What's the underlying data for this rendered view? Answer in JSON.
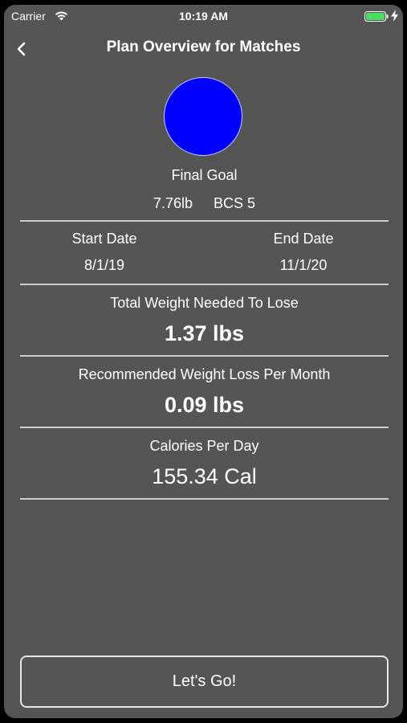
{
  "status_bar": {
    "carrier": "Carrier",
    "time": "10:19 AM",
    "battery_color": "#4cd964"
  },
  "nav": {
    "title": "Plan Overview for Matches",
    "back_icon": "chevron-left-icon"
  },
  "goal": {
    "avatar_color": "#0000ff",
    "label": "Final Goal",
    "weight": "7.76lb",
    "bcs": "BCS 5"
  },
  "dates": {
    "start_label": "Start Date",
    "start_value": "8/1/19",
    "end_label": "End Date",
    "end_value": "11/1/20"
  },
  "metrics": {
    "total_weight_label": "Total Weight Needed To Lose",
    "total_weight_value": "1.37 lbs",
    "monthly_loss_label": "Recommended Weight Loss Per Month",
    "monthly_loss_value": "0.09 lbs",
    "calories_label": "Calories Per Day",
    "calories_value": "155.34 Cal"
  },
  "action": {
    "button_label": "Let's Go!"
  }
}
